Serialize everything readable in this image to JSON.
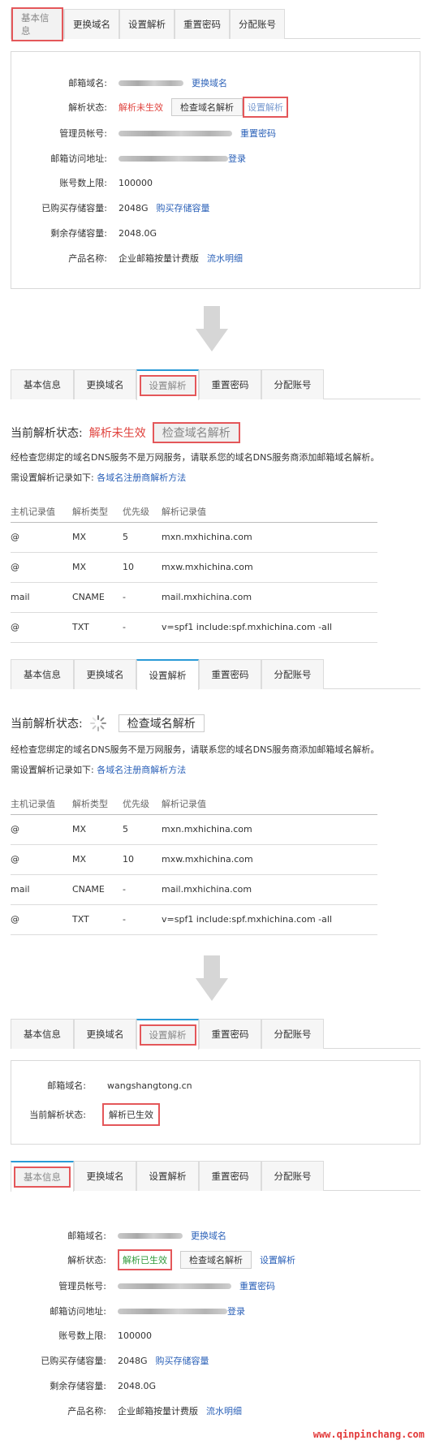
{
  "tabs": [
    "基本信息",
    "更换域名",
    "设置解析",
    "重置密码",
    "分配账号"
  ],
  "info_labels": {
    "mail_domain": "邮箱域名:",
    "dns_status": "解析状态:",
    "admin_account": "管理员帐号:",
    "mail_url": "邮箱访问地址:",
    "account_limit": "账号数上限:",
    "storage_bought": "已购买存储容量:",
    "storage_left": "剩余存储容量:",
    "product_name": "产品名称:"
  },
  "info_values": {
    "change_domain": "更换域名",
    "dns_not_effective": "解析未生效",
    "dns_effective": "解析已生效",
    "check_dns": "检查域名解析",
    "set_dns": "设置解析",
    "reset_password": "重置密码",
    "login": "登录",
    "account_limit": "100000",
    "storage_bought": "2048G",
    "buy_storage": "购买存储容量",
    "storage_left": "2048.0G",
    "product": "企业邮箱按量计费版",
    "billing": "流水明细"
  },
  "dns_panel": {
    "status_label": "当前解析状态:",
    "status_not_effective": "解析未生效",
    "check_button": "检查域名解析",
    "desc": "经检查您绑定的域名DNS服务不是万网服务，请联系您的域名DNS服务商添加邮箱域名解析。",
    "need_records": "需设置解析记录如下:",
    "methods_link": "各域名注册商解析方法",
    "headers": [
      "主机记录值",
      "解析类型",
      "优先级",
      "解析记录值"
    ],
    "records": [
      [
        "@",
        "MX",
        "5",
        "mxn.mxhichina.com"
      ],
      [
        "@",
        "MX",
        "10",
        "mxw.mxhichina.com"
      ],
      [
        "mail",
        "CNAME",
        "-",
        "mail.mxhichina.com"
      ],
      [
        "@",
        "TXT",
        "-",
        "v=spf1 include:spf.mxhichina.com -all"
      ]
    ]
  },
  "result_panel": {
    "domain_label": "邮箱域名:",
    "domain_value": "wangshangtong.cn",
    "status_label": "当前解析状态:",
    "status_value": "解析已生效"
  },
  "watermark": "www.qinpinchang.com"
}
